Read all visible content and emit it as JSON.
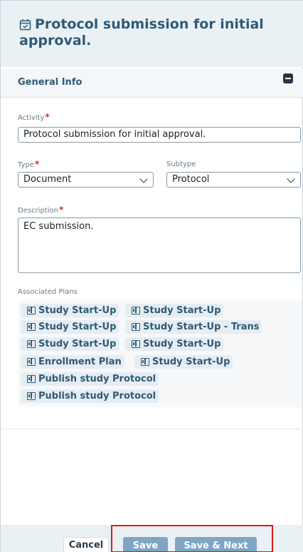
{
  "header": {
    "title": "Protocol submission for initial approval."
  },
  "section": {
    "title": "General Info"
  },
  "form": {
    "activity": {
      "label": "Activity",
      "value": "Protocol submission for initial approval."
    },
    "type": {
      "label": "Type",
      "value": "Document"
    },
    "subtype": {
      "label": "Subtype",
      "value": "Protocol"
    },
    "description": {
      "label": "Description",
      "value": "EC submission."
    },
    "associated_plans": {
      "label": "Associated Plans",
      "items": [
        "Study Start-Up",
        "Study Start-Up",
        "Study Start-Up",
        "Study Start-Up - Trans",
        "Study Start-Up",
        "Study Start-Up",
        "Enrollment Plan",
        "Study Start-Up",
        "Publish study Protocol",
        "Publish study Protocol"
      ]
    },
    "required_marker": "*"
  },
  "footer": {
    "cancel_label": "Cancel",
    "save_label": "Save",
    "save_next_label": "Save & Next"
  },
  "colors": {
    "accent": "#2e5a77",
    "button": "#7fa5c2",
    "required": "#d4272a",
    "highlight": "#e0181f"
  },
  "icons": {
    "header": "calendar-check-icon",
    "section": "collapse-minus-icon",
    "plan": "book-icon",
    "select": "chevron-down-icon"
  }
}
